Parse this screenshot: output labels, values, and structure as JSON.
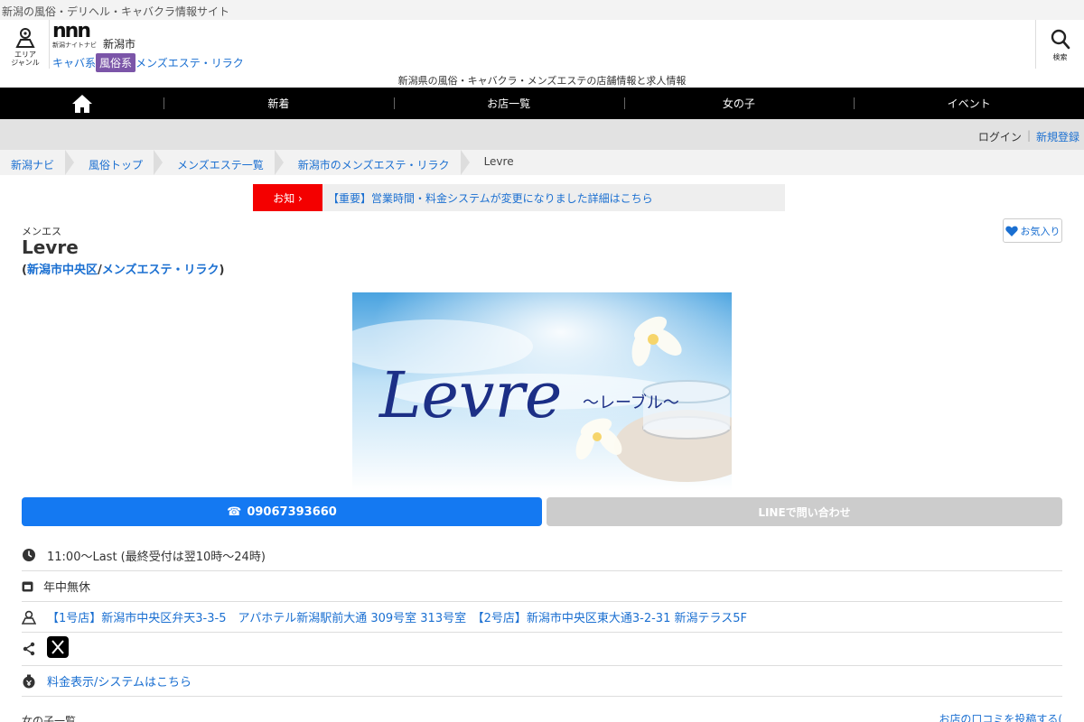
{
  "topstrip": {
    "text": "新潟の風俗・デリヘル・キャバクラ情報サイト"
  },
  "header": {
    "area_button": {
      "line1": "エリア",
      "line2": "ジャンル"
    },
    "logo": {
      "mark": "nnn",
      "sub": "新潟ナイトナビ"
    },
    "area_label": "新潟市",
    "genres": [
      "キャバ系",
      "風俗系",
      "メンズエステ・リラク"
    ],
    "active_genre_index": 1,
    "tagline": "新潟県の風俗・キャバクラ・メンズエステの店舗情報と求人情報",
    "search_label": "検索"
  },
  "nav": {
    "items": [
      "新着",
      "お店一覧",
      "女の子",
      "イベント"
    ]
  },
  "subbar": {
    "login": "ログイン",
    "register": "新規登録"
  },
  "breadcrumbs": [
    "新潟ナビ",
    "風俗トップ",
    "メンズエステ一覧",
    "新潟市のメンズエステ・リラク",
    "Levre"
  ],
  "notice": {
    "tag": "お知 ›",
    "text": "【重要】営業時間・料金システムが変更になりました詳細はこちら"
  },
  "shop": {
    "genre": "メンエス",
    "name": "Levre",
    "cat_open": "(",
    "cat_area": "新潟市中央区",
    "cat_sep": "/",
    "cat_genre": "メンズエステ・リラク",
    "cat_close": ")",
    "favorite": "お気入り",
    "hero_title": "Levre",
    "hero_sub": "～レーブル～"
  },
  "actions": {
    "tel_icon": "☎",
    "tel": "09067393660",
    "line": "LINEで問い合わせ"
  },
  "info": {
    "hours": "11:00～Last (最終受付は翌10時〜24時)",
    "holiday": "年中無休",
    "address": "【1号店】新潟市中央区弁天3-3-5　アパホテル新潟駅前大通 309号室 313号室　【2号店】新潟市中央区東大通3-2-31 新潟テラス5F",
    "price": "料金表示/システムはこちら"
  },
  "bottom": {
    "left": "女の子一覧",
    "right": "お店の口コミを投稿する("
  },
  "colors": {
    "nav_bg": "#000000",
    "tel_button": "#1479f2",
    "notice_tag": "#f40000",
    "active_genre": "#7b55a8",
    "link": "#1a6fd1"
  }
}
